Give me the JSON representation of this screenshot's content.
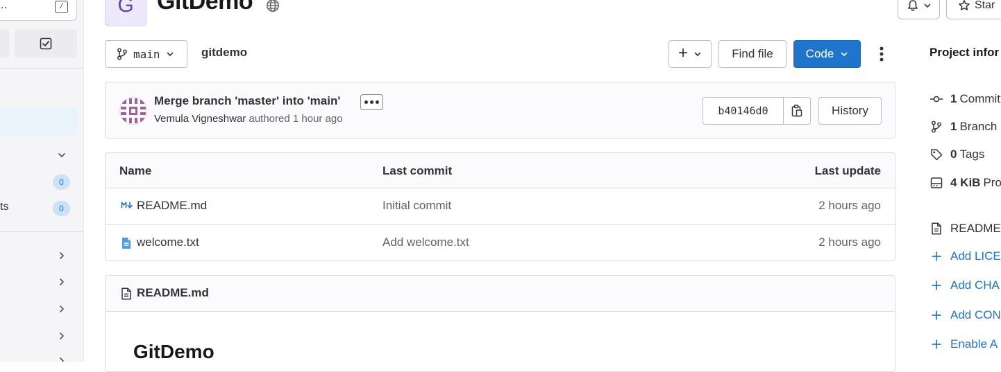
{
  "project": {
    "avatar_letter": "G",
    "name": "GitDemo"
  },
  "header": {
    "star_label": "Star"
  },
  "sidebar": {
    "search_ellipsis": "..",
    "search_shortcut": "/",
    "badges": [
      "0",
      "0"
    ],
    "cut_label": "ts"
  },
  "toolbar": {
    "branch": "main",
    "path": "gitdemo",
    "plus_label": "+",
    "find_file": "Find file",
    "code": "Code"
  },
  "last_commit": {
    "title": "Merge branch 'master' into 'main'",
    "author": "Vemula Vigneshwar",
    "action": "authored",
    "time": "1 hour ago",
    "sha": "b40146d0",
    "history": "History"
  },
  "file_table": {
    "headers": [
      "Name",
      "Last commit",
      "Last update"
    ],
    "rows": [
      {
        "name": "README.md",
        "icon": "markdown-icon",
        "commit": "Initial commit",
        "updated": "2 hours ago"
      },
      {
        "name": "welcome.txt",
        "icon": "text-file-icon",
        "commit": "Add welcome.txt",
        "updated": "2 hours ago"
      }
    ]
  },
  "readme": {
    "filename": "README.md",
    "heading": "GitDemo"
  },
  "project_info": {
    "title": "Project infor",
    "stats": [
      {
        "value": "1",
        "label": "Commit",
        "icon": "commit-icon"
      },
      {
        "value": "1",
        "label": "Branch",
        "icon": "branch-icon"
      },
      {
        "value": "0",
        "label": "Tags",
        "icon": "tag-icon"
      },
      {
        "value": "4 KiB",
        "label": "Pro",
        "icon": "storage-icon"
      }
    ],
    "links": [
      {
        "label": "README",
        "icon": "doc-icon"
      },
      {
        "label": "Add LICE",
        "icon": "plus-icon"
      },
      {
        "label": "Add CHA",
        "icon": "plus-icon"
      },
      {
        "label": "Add CON",
        "icon": "plus-icon"
      },
      {
        "label": "Enable A",
        "icon": "plus-icon"
      }
    ]
  },
  "colors": {
    "accent": "#1f75cb",
    "sidebar_bg": "#f5f4f7",
    "text": "#333238"
  }
}
